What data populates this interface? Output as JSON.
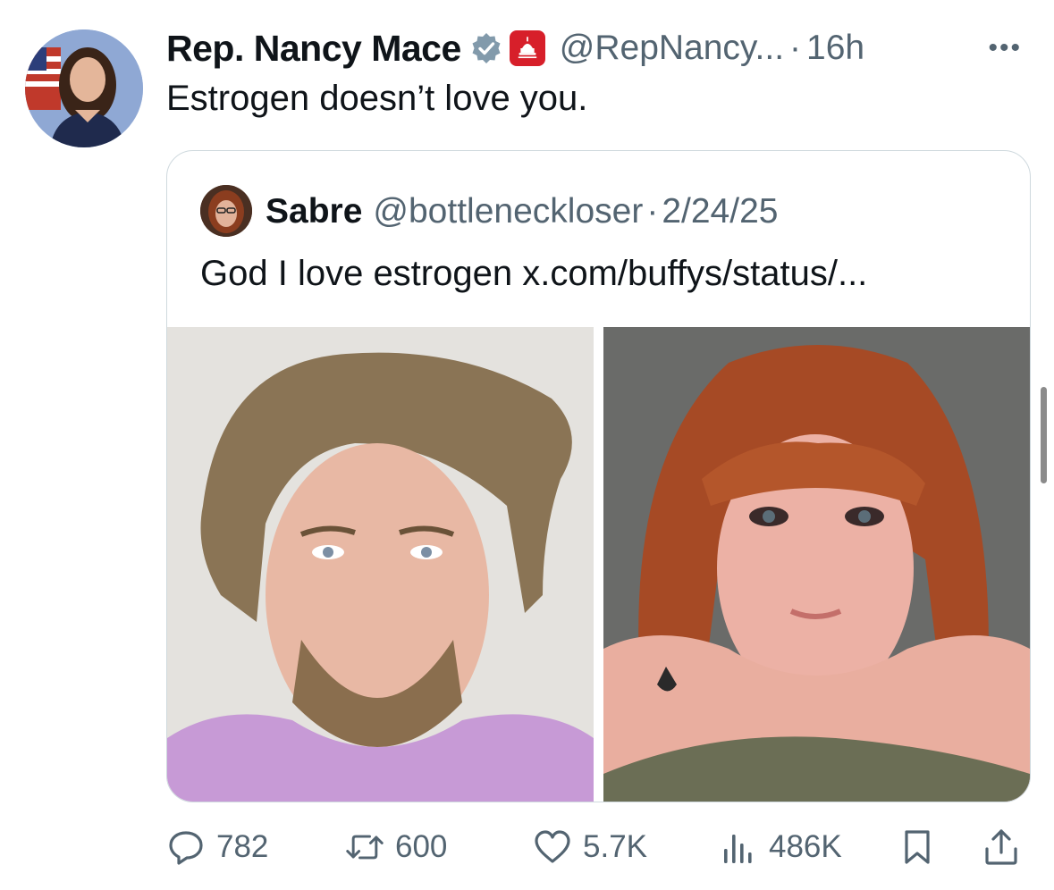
{
  "post": {
    "display_name": "Rep. Nancy Mace",
    "handle": "@RepNancy...",
    "separator": "·",
    "time": "16h",
    "text": "Estrogen doesn’t love you.",
    "more_icon": "more-icon",
    "verified_icon": "verified-badge-icon",
    "affiliation_icon": "capitol-affiliation-icon"
  },
  "quote": {
    "display_name": "Sabre",
    "handle": "@bottleneckloser",
    "separator": "·",
    "date": "2/24/25",
    "text": "God I love estrogen x.com/buffys/status/...",
    "images": [
      "before-photo",
      "after-photo"
    ]
  },
  "actions": {
    "replies": "782",
    "reposts": "600",
    "likes": "5.7K",
    "views": "486K",
    "icons": [
      "reply-icon",
      "repost-icon",
      "like-icon",
      "views-icon",
      "bookmark-icon",
      "share-icon"
    ]
  },
  "colors": {
    "text": "#0f1419",
    "muted": "#536471",
    "border": "#cfd9de",
    "affiliation": "#d71f2a"
  }
}
